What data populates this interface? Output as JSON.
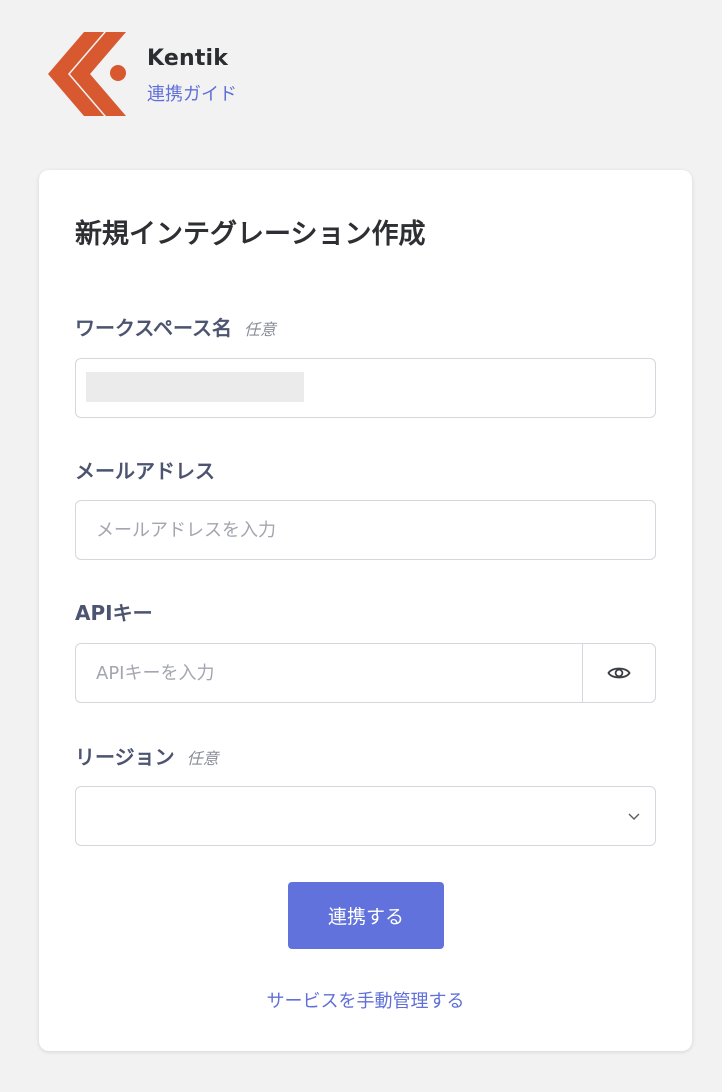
{
  "brand": {
    "name": "Kentik",
    "guide_link": "連携ガイド",
    "logo_color": "#d8582f"
  },
  "form": {
    "title": "新規インテグレーション作成",
    "workspace": {
      "label": "ワークスペース名",
      "optional": "任意",
      "value": ""
    },
    "email": {
      "label": "メールアドレス",
      "placeholder": "メールアドレスを入力"
    },
    "api_key": {
      "label": "APIキー",
      "placeholder": "APIキーを入力"
    },
    "region": {
      "label": "リージョン",
      "optional": "任意",
      "value": ""
    },
    "submit_label": "連携する",
    "manual_link": "サービスを手動管理する"
  },
  "colors": {
    "accent": "#6272dc",
    "link": "#6170d8",
    "label": "#4c5470"
  }
}
